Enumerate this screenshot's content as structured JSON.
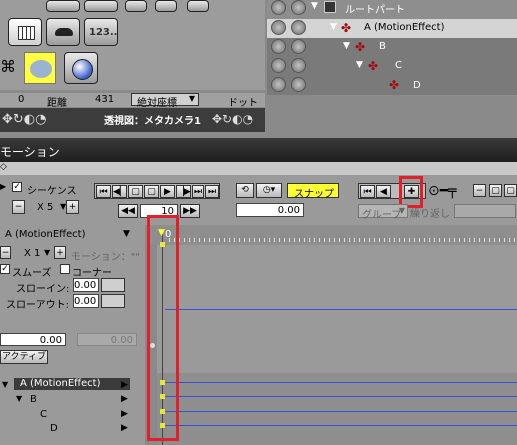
{
  "toolbar": {
    "distance_value": "0",
    "distance_label": "距離",
    "distance_value2": "431",
    "coord_mode": "絶対座標",
    "unit": "ドット",
    "calc_button": "123.."
  },
  "viewport": {
    "title": "透視図：メタカメラ1"
  },
  "scene_tree": {
    "root": "ルートパート",
    "items": [
      "A (MotionEffect)",
      "B",
      "C",
      "D"
    ]
  },
  "motion_window": {
    "title": "モーション",
    "sequence_label": "シーケンス",
    "seq_multiplier": "X 5",
    "frame_value": "10",
    "time_value": "0.00",
    "snap_label": "スナップ",
    "group_label": "グループ",
    "repeat_label": "繰り返し",
    "track_name": "A (MotionEffect)",
    "track_multiplier": "X 1",
    "motion_label": "モーション：\"\"",
    "smooth_label": "スムーズ",
    "corner_label": "コーナー",
    "slow_in_label": "スローイン:",
    "slow_in_value": "0.00",
    "slow_out_label": "スローアウト:",
    "slow_out_value": "0.00",
    "value_field": "0.00",
    "value_field2": "0.00",
    "active_button": "アクティブ",
    "ruler_start": "0",
    "tracks": [
      "A (MotionEffect)",
      "B",
      "C",
      "D"
    ]
  },
  "colors": {
    "accent_yellow": "#ffff33",
    "highlight_red": "#e0202a",
    "track_blue": "#3a4fd6"
  }
}
